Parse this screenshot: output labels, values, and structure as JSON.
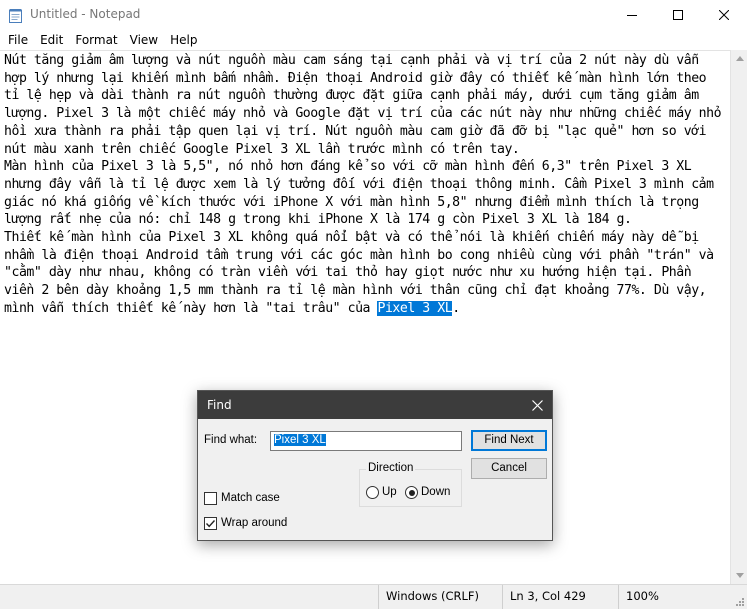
{
  "window": {
    "title": "Untitled - Notepad"
  },
  "menu": [
    "File",
    "Edit",
    "Format",
    "View",
    "Help"
  ],
  "editor": {
    "paragraphs": [
      "Nút tăng giảm âm lượng và nút nguồn màu cam sáng tại cạnh phải và vị trí của 2 nút này dù vẫn hợp lý nhưng lại khiến mình bấm nhầm. Điện thoại Android giờ đây có thiết kế màn hình lớn theo tỉ lệ hẹp và dài thành ra nút nguồn thường được đặt giữa cạnh phải máy, dưới cụm tăng giảm âm lượng. Pixel 3 là một chiếc máy nhỏ và Google đặt vị trí của các nút này như những chiếc máy nhỏ hồi xưa thành ra phải tập quen lại vị trí. Nút nguồn màu cam giờ đã đỡ bị \"lạc quẻ\" hơn so với nút màu xanh trên chiếc Google Pixel 3 XL lần trước mình có trên tay.",
      "Màn hình của Pixel 3 là 5,5\", nó nhỏ hơn đáng kể so với cỡ màn hình đến 6,3\" trên Pixel 3 XL nhưng đây vẫn là tỉ lệ được xem là lý tưởng đối với điện thoại thông minh. Cầm Pixel 3 mình cảm giác nó khá giống về kích thước với iPhone X với màn hình 5,8\" nhưng điểm mình thích là trọng lượng rất nhẹ của nó: chỉ 148 g trong khi iPhone X là 174 g còn Pixel 3 XL là 184 g."
    ],
    "last_paragraph_before": "Thiết kế màn hình của Pixel 3 XL không quá nổi bật và có thể nói là khiến chiến máy này dễ bị nhầm là điện thoại Android tầm trung với các góc màn hình bo cong nhiều cùng với phần \"trán\" và \"cằm\" dày như nhau, không có tràn viền với tai thỏ hay giọt nước như xu hướng hiện tại. Phần viền 2 bên dày khoảng 1,5 mm thành ra tỉ lệ màn hình với thân cũng chỉ đạt khoảng 77%. Dù vậy, mình vẫn thích thiết kế này hơn là \"tai trâu\" của ",
    "selected_text": "Pixel 3 XL",
    "last_paragraph_after": "."
  },
  "statusbar": {
    "line_ending": "Windows (CRLF)",
    "position": "Ln 3, Col 429",
    "zoom": "100%"
  },
  "find_dialog": {
    "title": "Find",
    "find_what_label": "Find what:",
    "find_what_value": "Pixel 3 XL",
    "find_next_label": "Find Next",
    "cancel_label": "Cancel",
    "direction_label": "Direction",
    "up_label": "Up",
    "down_label": "Down",
    "direction_selected": "down",
    "match_case_label": "Match case",
    "match_case_checked": false,
    "wrap_around_label": "Wrap around",
    "wrap_around_checked": true
  }
}
